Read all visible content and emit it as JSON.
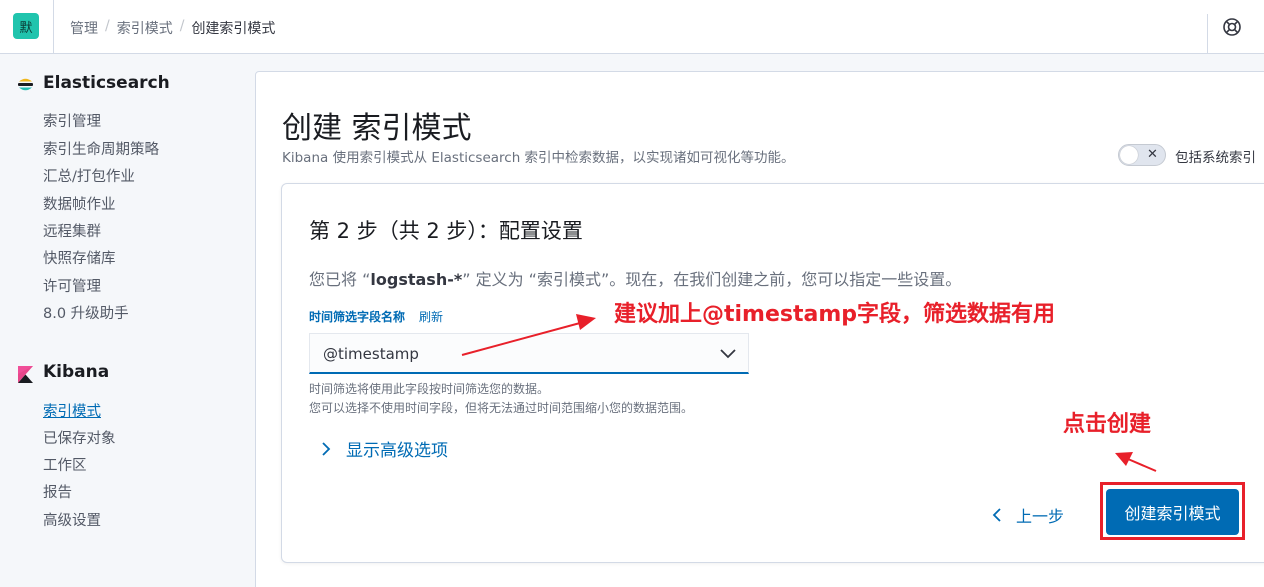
{
  "header": {
    "avatar_text": "默",
    "breadcrumbs": [
      "管理",
      "索引模式",
      "创建索引模式"
    ],
    "help_icon": "lifebuoy-icon"
  },
  "sidebar": {
    "sections": [
      {
        "title": "Elasticsearch",
        "icon": "elasticsearch-logo-icon",
        "items": [
          "索引管理",
          "索引生命周期策略",
          "汇总/打包作业",
          "数据帧作业",
          "远程集群",
          "快照存储库",
          "许可管理",
          "8.0 升级助手"
        ]
      },
      {
        "title": "Kibana",
        "icon": "kibana-logo-icon",
        "items": [
          "索引模式",
          "已保存对象",
          "工作区",
          "报告",
          "高级设置"
        ],
        "active_index": 0
      }
    ]
  },
  "main": {
    "title": "创建 索引模式",
    "description": "Kibana 使用索引模式从 Elasticsearch 索引中检索数据，以实现诸如可视化等功能。",
    "system_index_toggle": {
      "label": "包括系统索引",
      "checked": false
    },
    "step": {
      "title": "第 2 步（共 2 步）：配置设置",
      "desc_prefix": "您已将 “",
      "pattern": "logstash-*",
      "desc_suffix": "” 定义为 “索引模式”。现在，在我们创建之前，您可以指定一些设置。",
      "time_field_label": "时间筛选字段名称",
      "refresh_label": "刷新",
      "time_field_value": "@timestamp",
      "help_line_1": "时间筛选将使用此字段按时间筛选您的数据。",
      "help_line_2": "您可以选择不使用时间字段，但将无法通过时间范围缩小您的数据范围。",
      "advanced_label": "显示高级选项",
      "back_label": "上一步",
      "create_label": "创建索引模式"
    }
  },
  "annotations": {
    "field_tip": "建议加上@timestamp字段，筛选数据有用",
    "click_tip": "点击创建",
    "color": "#e8202a"
  },
  "colors": {
    "primary": "#006bb4",
    "avatar_bg": "#20c4ad",
    "annotation": "#e8202a"
  }
}
